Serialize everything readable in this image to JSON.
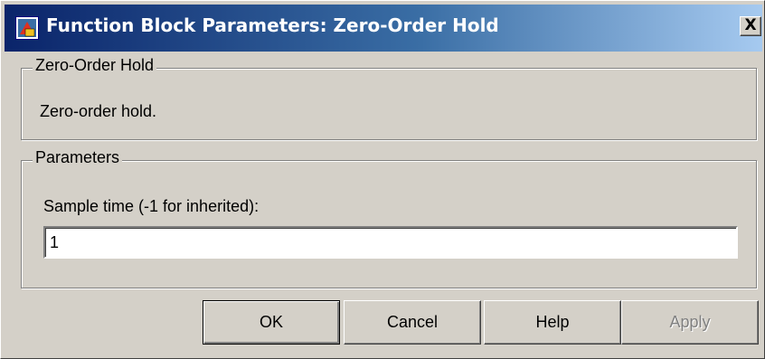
{
  "window": {
    "title": "Function Block Parameters: Zero-Order Hold",
    "close_label": "X",
    "title_icon": "simulink-block-icon"
  },
  "description_group": {
    "legend": "Zero-Order Hold",
    "text": "Zero-order hold."
  },
  "parameters_group": {
    "legend": "Parameters",
    "sample_time_label": "Sample time (-1 for inherited):",
    "sample_time_value": "1"
  },
  "buttons": {
    "ok": "OK",
    "cancel": "Cancel",
    "help": "Help",
    "apply": "Apply"
  },
  "colors": {
    "titlebar_start": "#0a246a",
    "titlebar_end": "#a6caf0",
    "face": "#d4d0c8",
    "disabled_text": "#808080"
  }
}
